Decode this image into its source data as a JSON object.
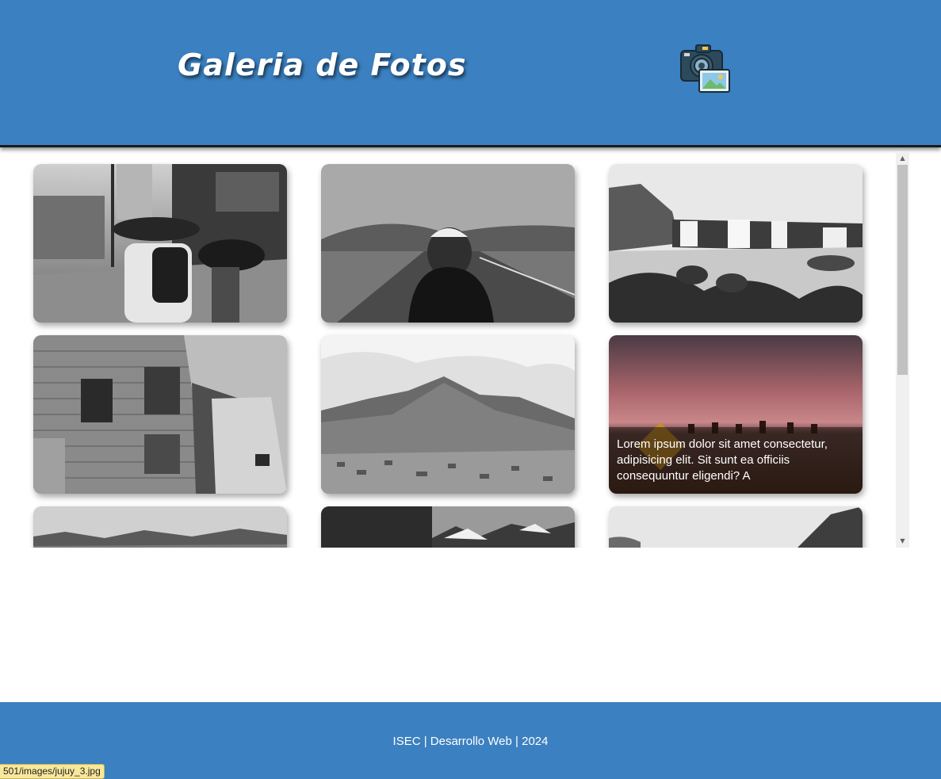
{
  "header": {
    "title": "Galeria de Fotos",
    "logo_icon": "camera-with-photo-icon",
    "background_color": "#3b80c0"
  },
  "gallery": {
    "photos": [
      {
        "name": "rainy-street-umbrellas",
        "caption": ""
      },
      {
        "name": "road-man-cap",
        "caption": ""
      },
      {
        "name": "waterfalls",
        "caption": ""
      },
      {
        "name": "tin-houses",
        "caption": ""
      },
      {
        "name": "mountain-town",
        "caption": ""
      },
      {
        "name": "llamas-sunset",
        "caption": "Lorem ipsum dolor sit amet consectetur, adipisicing elit. Sit sunt ea officiis consequuntur eligendi? A"
      },
      {
        "name": "mountain-range",
        "caption": ""
      },
      {
        "name": "forest-peaks",
        "caption": ""
      },
      {
        "name": "misty-cliff",
        "caption": ""
      }
    ]
  },
  "footer": {
    "text": "ISEC | Desarrollo Web | 2024",
    "background_color": "#3b80c0"
  },
  "status_bar": {
    "url": "501/images/jujuy_3.jpg"
  },
  "scrollbar": {
    "up_icon": "triangle-up-icon",
    "down_icon": "triangle-down-icon"
  }
}
